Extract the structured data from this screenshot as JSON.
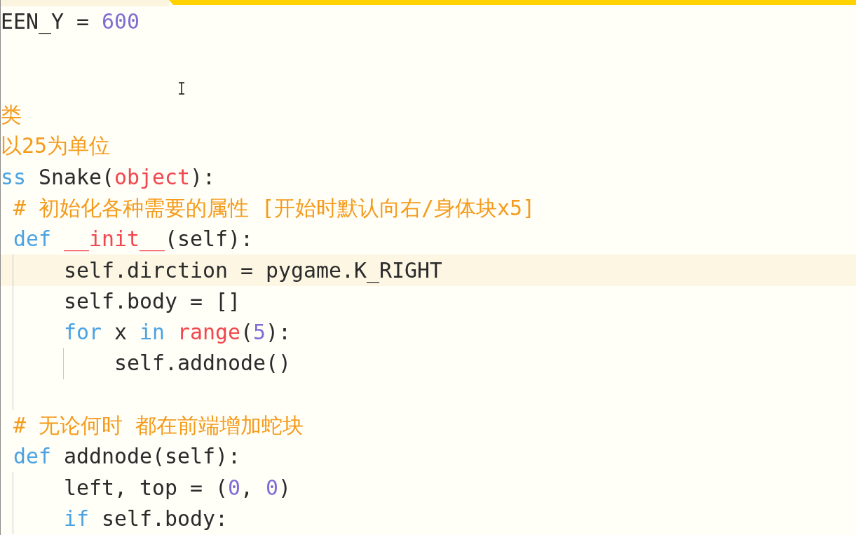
{
  "editor": {
    "lines": [
      {
        "kind": "code",
        "current": false,
        "tokens": [
          {
            "kind": "text",
            "text": "EEN_Y = "
          },
          {
            "kind": "number",
            "text": "600"
          }
        ]
      },
      {
        "kind": "blank",
        "current": false
      },
      {
        "kind": "blank",
        "current": false
      },
      {
        "kind": "code",
        "current": false,
        "tokens": [
          {
            "kind": "comment",
            "text": "类"
          }
        ]
      },
      {
        "kind": "code",
        "current": false,
        "tokens": [
          {
            "kind": "comment",
            "text": "以25为单位"
          }
        ]
      },
      {
        "kind": "code",
        "current": false,
        "tokens": [
          {
            "kind": "keyword",
            "text": "ss"
          },
          {
            "kind": "text",
            "text": " Snake("
          },
          {
            "kind": "builtin",
            "text": "object"
          },
          {
            "kind": "text",
            "text": "):"
          }
        ],
        "children": [
          {
            "kind": "code",
            "current": false,
            "tokens": [
              {
                "kind": "comment",
                "text": "# 初始化各种需要的属性 [开始时默认向右/身体块x5]"
              }
            ]
          },
          {
            "kind": "code",
            "current": false,
            "tokens": [
              {
                "kind": "keyword",
                "text": "def"
              },
              {
                "kind": "builtin",
                "text": " __init__"
              },
              {
                "kind": "text",
                "text": "(self):"
              }
            ],
            "children": [
              {
                "kind": "code",
                "current": true,
                "tokens": [
                  {
                    "kind": "text",
                    "text": "self.dirction = pygame.K_RIGHT"
                  }
                ]
              },
              {
                "kind": "code",
                "current": false,
                "tokens": [
                  {
                    "kind": "text",
                    "text": "self.body = []"
                  }
                ]
              },
              {
                "kind": "code",
                "current": false,
                "tokens": [
                  {
                    "kind": "keyword",
                    "text": "for"
                  },
                  {
                    "kind": "text",
                    "text": " x "
                  },
                  {
                    "kind": "keyword",
                    "text": "in"
                  },
                  {
                    "kind": "builtin",
                    "text": " range"
                  },
                  {
                    "kind": "text",
                    "text": "("
                  },
                  {
                    "kind": "number",
                    "text": "5"
                  },
                  {
                    "kind": "text",
                    "text": "):"
                  }
                ],
                "children": [
                  {
                    "kind": "code",
                    "current": false,
                    "tokens": [
                      {
                        "kind": "text",
                        "text": "self.addnode()"
                      }
                    ]
                  }
                ]
              },
              {
                "kind": "blank",
                "current": false
              }
            ]
          },
          {
            "kind": "code",
            "current": false,
            "tokens": [
              {
                "kind": "comment",
                "text": "# 无论何时 都在前端增加蛇块"
              }
            ]
          },
          {
            "kind": "code",
            "current": false,
            "tokens": [
              {
                "kind": "keyword",
                "text": "def"
              },
              {
                "kind": "text",
                "text": " addnode(self):"
              }
            ],
            "children": [
              {
                "kind": "code",
                "current": false,
                "tokens": [
                  {
                    "kind": "text",
                    "text": "left, top = ("
                  },
                  {
                    "kind": "number",
                    "text": "0"
                  },
                  {
                    "kind": "text",
                    "text": ", "
                  },
                  {
                    "kind": "number",
                    "text": "0"
                  },
                  {
                    "kind": "text",
                    "text": ")"
                  }
                ]
              },
              {
                "kind": "code",
                "current": false,
                "tokens": [
                  {
                    "kind": "keyword",
                    "text": "if"
                  },
                  {
                    "kind": "text",
                    "text": " self.body:"
                  }
                ]
              }
            ]
          }
        ]
      }
    ]
  }
}
